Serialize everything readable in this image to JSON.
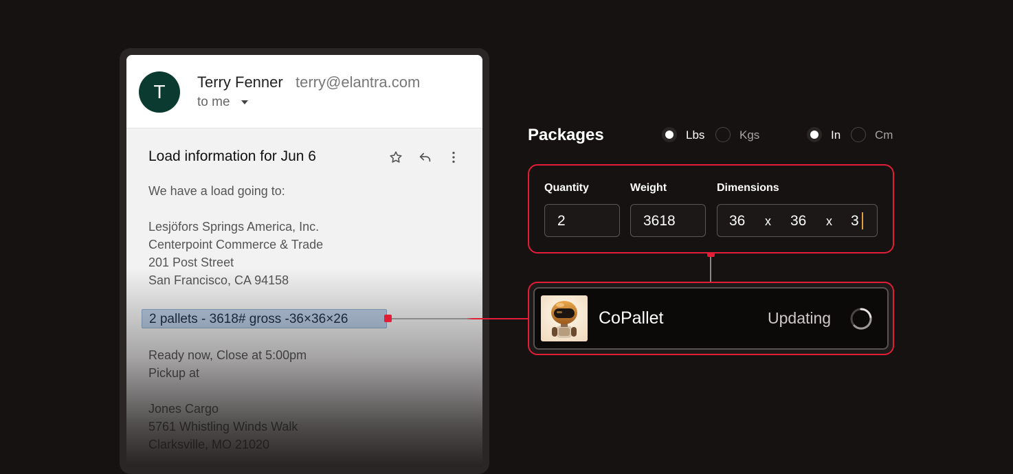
{
  "email": {
    "sender_initial": "T",
    "sender_name": "Terry Fenner",
    "sender_email": "terry@elantra.com",
    "recipient": "to me",
    "subject": "Load information for Jun 6",
    "lines": {
      "l1": "We have a load going to:",
      "l2": "Lesjöfors Springs America, Inc.",
      "l3": "Centerpoint Commerce & Trade",
      "l4": "201 Post Street",
      "l5": "San Francisco, CA 94158",
      "highlight": "2 pallets - 3618# gross -36×36×26",
      "l6": "Ready now, Close at 5:00pm",
      "l7": "Pickup at",
      "l8": "Jones Cargo",
      "l9": "5761 Whistling Winds Walk",
      "l10": "Clarksville, MO 21020"
    },
    "icons": [
      "avatar",
      "chevron-down-icon",
      "star-icon",
      "reply-icon",
      "more-vert-icon"
    ]
  },
  "packages": {
    "title": "Packages",
    "weight_units": [
      {
        "label": "Lbs",
        "selected": true
      },
      {
        "label": "Kgs",
        "selected": false
      }
    ],
    "dim_units": [
      {
        "label": "In",
        "selected": true
      },
      {
        "label": "Cm",
        "selected": false
      }
    ],
    "quantity_label": "Quantity",
    "weight_label": "Weight",
    "dimensions_label": "Dimensions",
    "quantity": "2",
    "weight": "3618",
    "dim_length": "36",
    "dim_width": "36",
    "dim_height": "3",
    "dim_sep": "x"
  },
  "copallet": {
    "name": "CoPallet",
    "status": "Updating"
  },
  "colors": {
    "accent": "#e21d35",
    "background": "#161212",
    "avatar": "#0b3b30",
    "highlight": "#b9cde4"
  }
}
